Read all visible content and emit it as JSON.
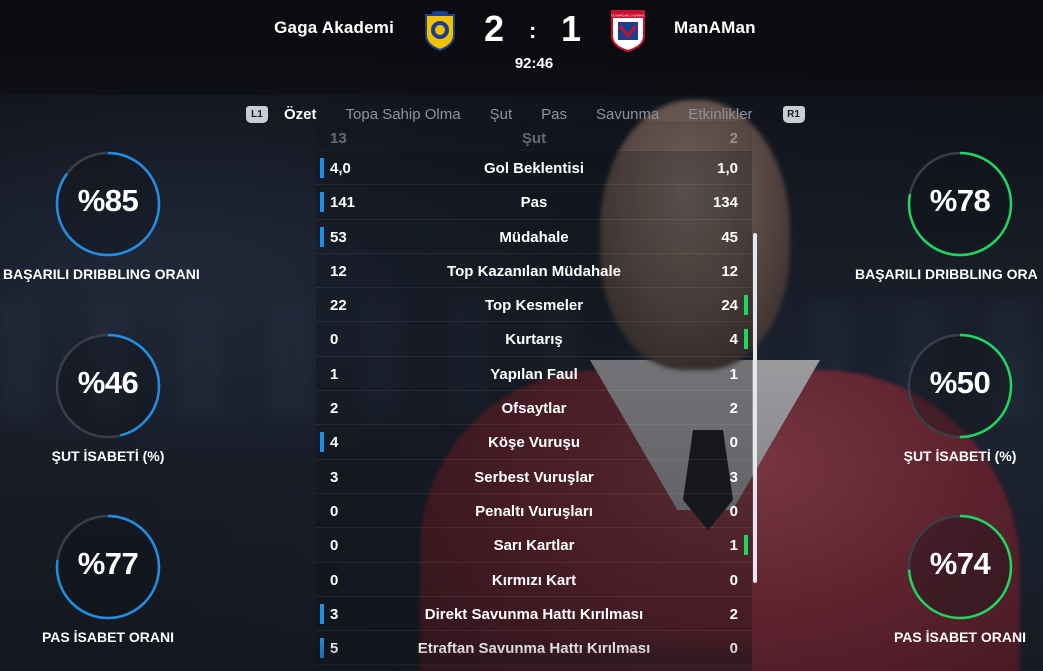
{
  "match": {
    "home_team": "Gaga Akademi",
    "away_team": "ManAMan",
    "home_score": "2",
    "separator": ":",
    "away_score": "1",
    "clock": "92:46",
    "away_crest_text": "OLYMPIQUE LYONNAIS"
  },
  "tabs": {
    "left_button": "L1",
    "right_button": "R1",
    "items": [
      "Özet",
      "Topa Sahip Olma",
      "Şut",
      "Pas",
      "Savunma",
      "Etkinlikler"
    ],
    "active": "Özet"
  },
  "stats": [
    {
      "name": "Şut",
      "home": "13",
      "away": "2",
      "lead": "none"
    },
    {
      "name": "Gol Beklentisi",
      "home": "4,0",
      "away": "1,0",
      "lead": "left"
    },
    {
      "name": "Pas",
      "home": "141",
      "away": "134",
      "lead": "left"
    },
    {
      "name": "Müdahale",
      "home": "53",
      "away": "45",
      "lead": "left"
    },
    {
      "name": "Top Kazanılan Müdahale",
      "home": "12",
      "away": "12",
      "lead": "none"
    },
    {
      "name": "Top Kesmeler",
      "home": "22",
      "away": "24",
      "lead": "right"
    },
    {
      "name": "Kurtarış",
      "home": "0",
      "away": "4",
      "lead": "right"
    },
    {
      "name": "Yapılan Faul",
      "home": "1",
      "away": "1",
      "lead": "none"
    },
    {
      "name": "Ofsaytlar",
      "home": "2",
      "away": "2",
      "lead": "none"
    },
    {
      "name": "Köşe Vuruşu",
      "home": "4",
      "away": "0",
      "lead": "left"
    },
    {
      "name": "Serbest Vuruşlar",
      "home": "3",
      "away": "3",
      "lead": "none"
    },
    {
      "name": "Penaltı Vuruşları",
      "home": "0",
      "away": "0",
      "lead": "none"
    },
    {
      "name": "Sarı Kartlar",
      "home": "0",
      "away": "1",
      "lead": "right"
    },
    {
      "name": "Kırmızı Kart",
      "home": "0",
      "away": "0",
      "lead": "none"
    },
    {
      "name": "Direkt Savunma Hattı Kırılması",
      "home": "3",
      "away": "2",
      "lead": "left"
    },
    {
      "name": "Etraftan Savunma Hattı Kırılması",
      "home": "5",
      "away": "0",
      "lead": "left"
    }
  ],
  "gauges": {
    "home": [
      {
        "value": "%85",
        "fraction": 0.85,
        "label": "BAŞARILI DRIBBLING ORANI"
      },
      {
        "value": "%46",
        "fraction": 0.46,
        "label": "ŞUT İSABETİ (%)"
      },
      {
        "value": "%77",
        "fraction": 0.77,
        "label": "PAS İSABET ORANI"
      }
    ],
    "away": [
      {
        "value": "%78",
        "fraction": 0.78,
        "label": "BAŞARILI DRIBBLING ORA"
      },
      {
        "value": "%50",
        "fraction": 0.5,
        "label": "ŞUT İSABETİ (%)"
      },
      {
        "value": "%74",
        "fraction": 0.74,
        "label": "PAS İSABET ORANI"
      }
    ]
  },
  "colors": {
    "home_accent": "#1f8fe6",
    "away_accent": "#1ed760",
    "ring_track": "#3a3f47"
  }
}
